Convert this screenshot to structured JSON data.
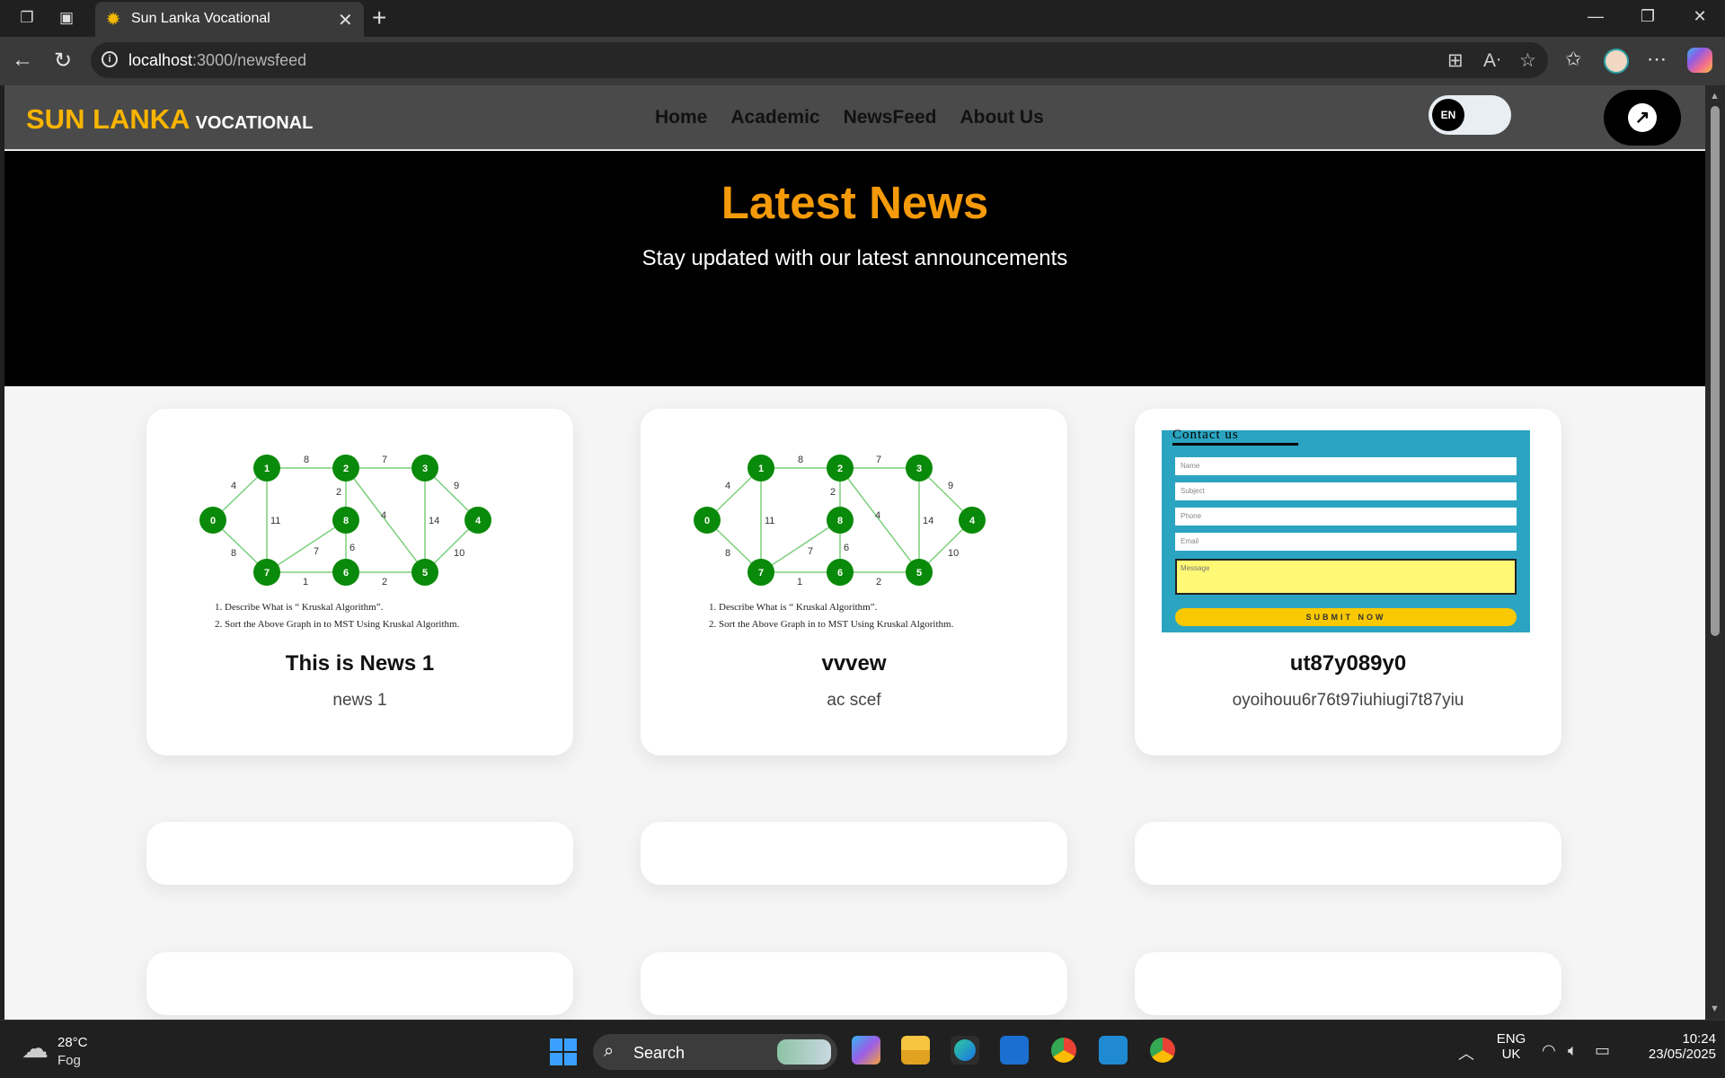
{
  "browser": {
    "tab_title": "Sun Lanka Vocational",
    "url_host": "localhost",
    "url_path": ":3000/newsfeed"
  },
  "site": {
    "brand": "SUN LANKA",
    "brand_sub": "VOCATIONAL",
    "nav": [
      "Home",
      "Academic",
      "NewsFeed",
      "About Us"
    ],
    "lang_label": "EN"
  },
  "hero": {
    "title": "Latest News",
    "subtitle": "Stay updated with our latest announcements"
  },
  "news": [
    {
      "title": "This is News 1",
      "desc": "news 1"
    },
    {
      "title": "vvvew",
      "desc": "ac scef"
    },
    {
      "title": "ut87y089y0",
      "desc": "oyoihouu6r76t97iuhiugi7t87yiu"
    }
  ],
  "graph_image": {
    "items": [
      "1.  Describe What is “ Kruskal Algorithm”.",
      "2.  Sort the Above Graph in to MST Using Kruskal Algorithm."
    ],
    "node_color": "#0a8a0a"
  },
  "contact_image": {
    "title": "Contact us",
    "fields": [
      "Name",
      "Subject",
      "Phone",
      "Email"
    ],
    "message_placeholder": "Message",
    "button": "SUBMIT NOW"
  },
  "taskbar": {
    "temp": "28°C",
    "weather": "Fog",
    "search": "Search",
    "lang_top": "ENG",
    "lang_bottom": "UK",
    "time": "10:24",
    "date": "23/05/2025"
  },
  "colors": {
    "brand": "#f8b400",
    "hero_title": "#f59a0a"
  }
}
